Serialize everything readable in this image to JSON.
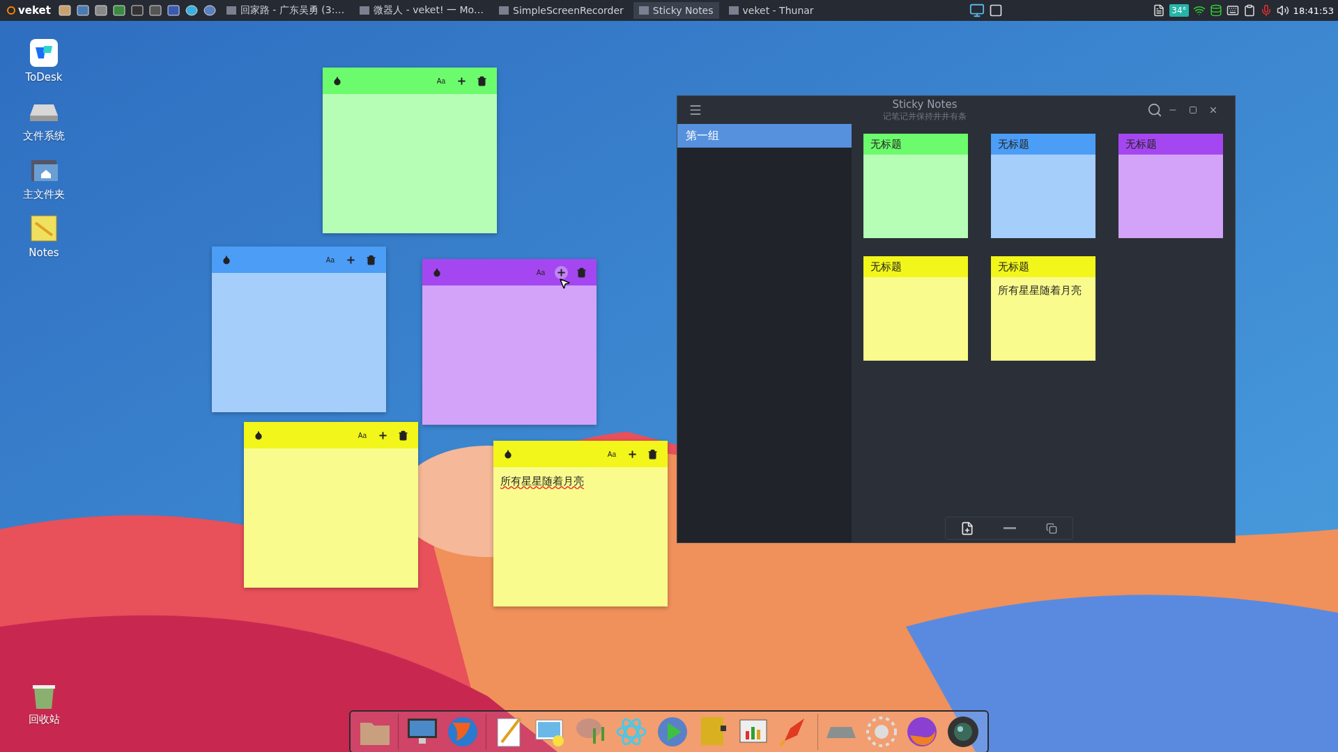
{
  "panel": {
    "menu_label": "veket",
    "tasks": [
      {
        "title": "回家路 - 广东吴勇 (3:…",
        "selected": false
      },
      {
        "title": "微器人 - veket! 一 Mo…",
        "selected": false
      },
      {
        "title": "SimpleScreenRecorder",
        "selected": false
      },
      {
        "title": "Sticky Notes",
        "selected": true
      },
      {
        "title": "veket - Thunar",
        "selected": false
      }
    ],
    "temperature": "34°",
    "clock": "18:41:53"
  },
  "desktop_icons": [
    {
      "label": "ToDesk",
      "kind": "todesk"
    },
    {
      "label": "文件系统",
      "kind": "drive"
    },
    {
      "label": "主文件夹",
      "kind": "home"
    },
    {
      "label": "Notes",
      "kind": "notes"
    }
  ],
  "trash_icon": {
    "label": "回收站"
  },
  "notes": [
    {
      "color": "#6cfb6c",
      "font_label": "Aa"
    },
    {
      "color": "#4b9df6",
      "font_label": "Aa"
    },
    {
      "color": "#a547f0",
      "font_label": "Aa",
      "plus_hovered": true
    },
    {
      "color": "#f2f61a",
      "font_label": "Aa"
    },
    {
      "color": "#f2f61a",
      "font_label": "Aa",
      "text": "所有星星随着月亮"
    }
  ],
  "window": {
    "title": "Sticky Notes",
    "subtitle": "记笔记并保持井井有条",
    "groups": [
      {
        "label": "第一组",
        "selected": true
      }
    ],
    "cards": [
      {
        "title": "无标题",
        "color": "#6cfb6c"
      },
      {
        "title": "无标题",
        "color": "#4b9df6"
      },
      {
        "title": "无标题",
        "color": "#a547f0"
      },
      {
        "title": "无标题",
        "color": "#f2f61a"
      },
      {
        "title": "无标题",
        "color": "#f2f61a",
        "text": "所有星星随着月亮"
      }
    ]
  }
}
